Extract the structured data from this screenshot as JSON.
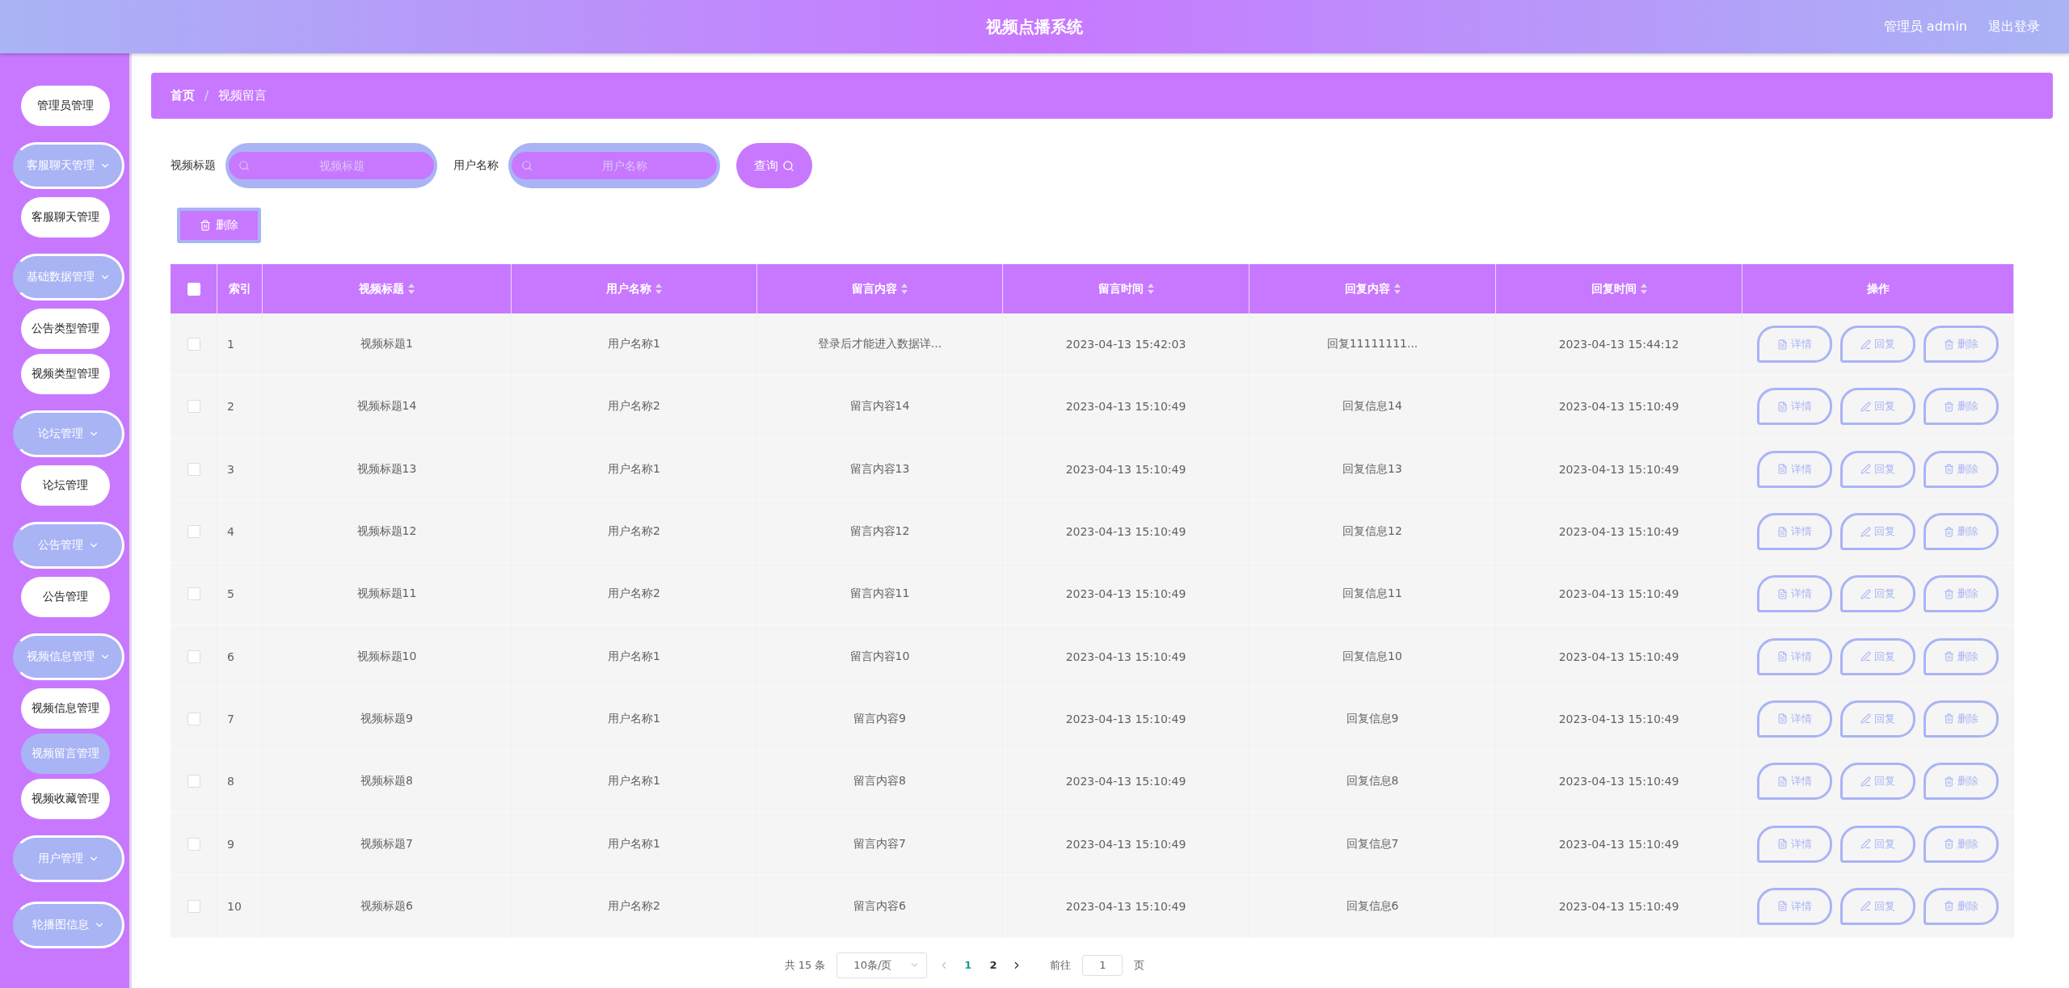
{
  "header": {
    "title": "视频点播系统",
    "user": "管理员 admin",
    "logout": "退出登录"
  },
  "sidebar": [
    {
      "kind": "item",
      "label": "管理员管理",
      "selected": false
    },
    {
      "kind": "group",
      "label": "客服聊天管理"
    },
    {
      "kind": "item",
      "label": "客服聊天管理",
      "selected": false
    },
    {
      "kind": "group",
      "label": "基础数据管理"
    },
    {
      "kind": "item",
      "label": "公告类型管理",
      "selected": false
    },
    {
      "kind": "item",
      "label": "视频类型管理",
      "selected": false
    },
    {
      "kind": "group",
      "label": "论坛管理"
    },
    {
      "kind": "item",
      "label": "论坛管理",
      "selected": false
    },
    {
      "kind": "group",
      "label": "公告管理"
    },
    {
      "kind": "item",
      "label": "公告管理",
      "selected": false
    },
    {
      "kind": "group",
      "label": "视频信息管理"
    },
    {
      "kind": "item",
      "label": "视频信息管理",
      "selected": false
    },
    {
      "kind": "item",
      "label": "视频留言管理",
      "selected": true
    },
    {
      "kind": "item",
      "label": "视频收藏管理",
      "selected": false
    },
    {
      "kind": "group",
      "label": "用户管理"
    },
    {
      "kind": "group",
      "label": "轮播图信息"
    }
  ],
  "breadcrumb": {
    "items": [
      "首页",
      "视频留言"
    ],
    "separator": "/"
  },
  "search": {
    "fields": [
      {
        "label": "视频标题",
        "placeholder": "视频标题"
      },
      {
        "label": "用户名称",
        "placeholder": "用户名称"
      }
    ],
    "button": "查询"
  },
  "delete_button": "删除",
  "table": {
    "header_checked": false,
    "columns": [
      {
        "label": "索引",
        "sortable": false
      },
      {
        "label": "视频标题",
        "sortable": true
      },
      {
        "label": "用户名称",
        "sortable": true
      },
      {
        "label": "留言内容",
        "sortable": true
      },
      {
        "label": "留言时间",
        "sortable": true
      },
      {
        "label": "回复内容",
        "sortable": true
      },
      {
        "label": "回复时间",
        "sortable": true
      },
      {
        "label": "操作",
        "sortable": false
      }
    ],
    "rows": [
      {
        "checked": false,
        "cells": [
          "1",
          "视频标题1",
          "用户名称1",
          "登录后才能进入数据详...",
          "2023-04-13 15:42:03",
          "回复11111111...",
          "2023-04-13 15:44:12"
        ],
        "actions": [
          {
            "kind": "detail",
            "label": "详情"
          },
          {
            "kind": "reply",
            "label": "回复"
          },
          {
            "kind": "delete",
            "label": "删除"
          }
        ]
      },
      {
        "checked": false,
        "cells": [
          "2",
          "视频标题14",
          "用户名称2",
          "留言内容14",
          "2023-04-13 15:10:49",
          "回复信息14",
          "2023-04-13 15:10:49"
        ],
        "actions": [
          {
            "kind": "detail",
            "label": "详情"
          },
          {
            "kind": "reply",
            "label": "回复"
          },
          {
            "kind": "delete",
            "label": "删除"
          }
        ]
      },
      {
        "checked": false,
        "cells": [
          "3",
          "视频标题13",
          "用户名称1",
          "留言内容13",
          "2023-04-13 15:10:49",
          "回复信息13",
          "2023-04-13 15:10:49"
        ],
        "actions": [
          {
            "kind": "detail",
            "label": "详情"
          },
          {
            "kind": "reply",
            "label": "回复"
          },
          {
            "kind": "delete",
            "label": "删除"
          }
        ]
      },
      {
        "checked": false,
        "cells": [
          "4",
          "视频标题12",
          "用户名称2",
          "留言内容12",
          "2023-04-13 15:10:49",
          "回复信息12",
          "2023-04-13 15:10:49"
        ],
        "actions": [
          {
            "kind": "detail",
            "label": "详情"
          },
          {
            "kind": "reply",
            "label": "回复"
          },
          {
            "kind": "delete",
            "label": "删除"
          }
        ]
      },
      {
        "checked": false,
        "cells": [
          "5",
          "视频标题11",
          "用户名称2",
          "留言内容11",
          "2023-04-13 15:10:49",
          "回复信息11",
          "2023-04-13 15:10:49"
        ],
        "actions": [
          {
            "kind": "detail",
            "label": "详情"
          },
          {
            "kind": "reply",
            "label": "回复"
          },
          {
            "kind": "delete",
            "label": "删除"
          }
        ]
      },
      {
        "checked": false,
        "cells": [
          "6",
          "视频标题10",
          "用户名称1",
          "留言内容10",
          "2023-04-13 15:10:49",
          "回复信息10",
          "2023-04-13 15:10:49"
        ],
        "actions": [
          {
            "kind": "detail",
            "label": "详情"
          },
          {
            "kind": "reply",
            "label": "回复"
          },
          {
            "kind": "delete",
            "label": "删除"
          }
        ]
      },
      {
        "checked": false,
        "cells": [
          "7",
          "视频标题9",
          "用户名称1",
          "留言内容9",
          "2023-04-13 15:10:49",
          "回复信息9",
          "2023-04-13 15:10:49"
        ],
        "actions": [
          {
            "kind": "detail",
            "label": "详情"
          },
          {
            "kind": "reply",
            "label": "回复"
          },
          {
            "kind": "delete",
            "label": "删除"
          }
        ]
      },
      {
        "checked": false,
        "cells": [
          "8",
          "视频标题8",
          "用户名称1",
          "留言内容8",
          "2023-04-13 15:10:49",
          "回复信息8",
          "2023-04-13 15:10:49"
        ],
        "actions": [
          {
            "kind": "detail",
            "label": "详情"
          },
          {
            "kind": "reply",
            "label": "回复"
          },
          {
            "kind": "delete",
            "label": "删除"
          }
        ]
      },
      {
        "checked": false,
        "cells": [
          "9",
          "视频标题7",
          "用户名称1",
          "留言内容7",
          "2023-04-13 15:10:49",
          "回复信息7",
          "2023-04-13 15:10:49"
        ],
        "actions": [
          {
            "kind": "detail",
            "label": "详情"
          },
          {
            "kind": "reply",
            "label": "回复"
          },
          {
            "kind": "delete",
            "label": "删除"
          }
        ]
      },
      {
        "checked": false,
        "cells": [
          "10",
          "视频标题6",
          "用户名称2",
          "留言内容6",
          "2023-04-13 15:10:49",
          "回复信息6",
          "2023-04-13 15:10:49"
        ],
        "actions": [
          {
            "kind": "detail",
            "label": "详情"
          },
          {
            "kind": "reply",
            "label": "回复"
          },
          {
            "kind": "delete",
            "label": "删除"
          }
        ]
      }
    ]
  },
  "pagination": {
    "total": "共 15 条",
    "page_size": "10条/页",
    "pages": [
      {
        "label": "1",
        "selected": true
      },
      {
        "label": "2",
        "selected": false
      }
    ],
    "goto_label": "前往",
    "goto_value": "1",
    "goto_suffix": "页"
  }
}
